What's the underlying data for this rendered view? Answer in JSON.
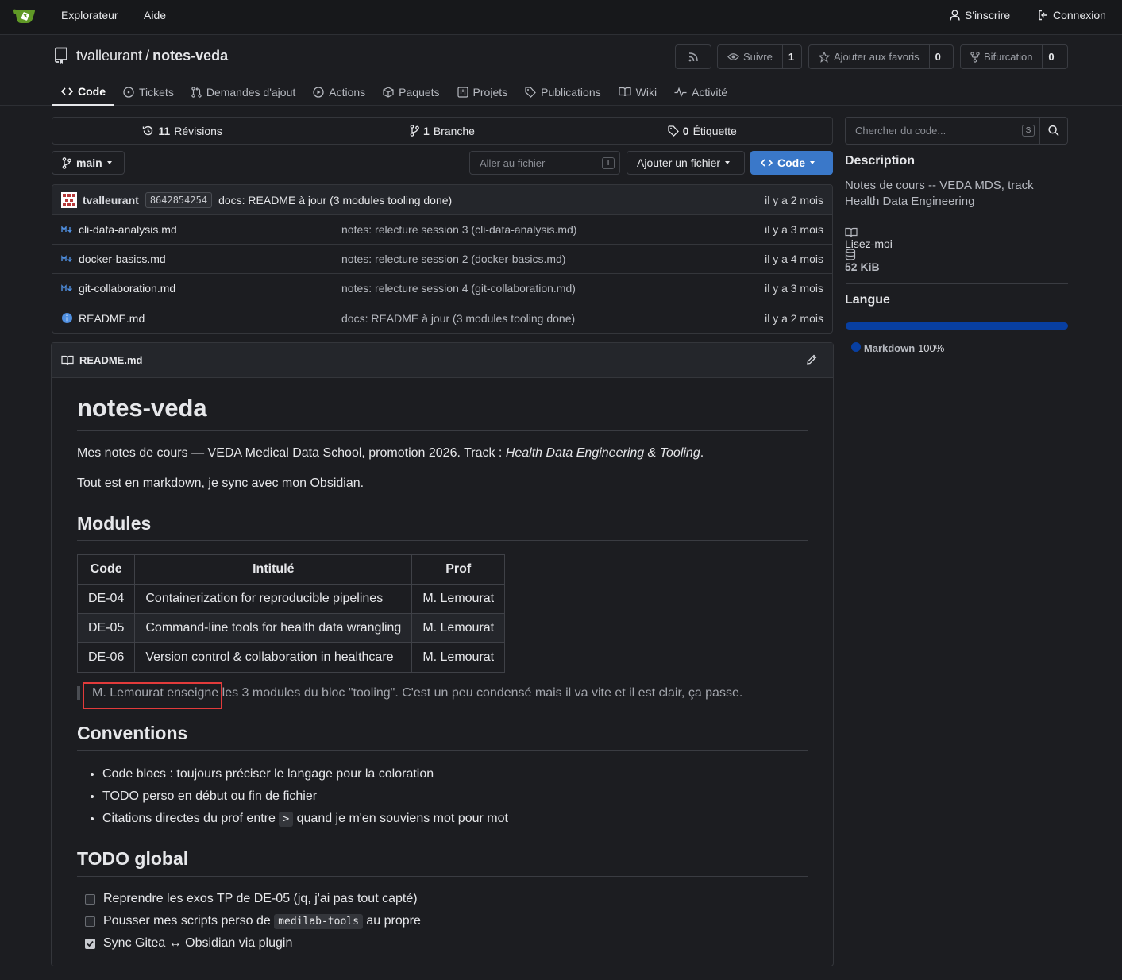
{
  "topnav": {
    "explorer": "Explorateur",
    "help": "Aide",
    "signup": "S'inscrire",
    "signin": "Connexion"
  },
  "repo": {
    "owner": "tvalleurant",
    "separator": "/",
    "name": "notes-veda",
    "watch_label": "Suivre",
    "watch_count": "1",
    "star_label": "Ajouter aux favoris",
    "star_count": "0",
    "fork_label": "Bifurcation",
    "fork_count": "0"
  },
  "tabs": [
    {
      "label": "Code"
    },
    {
      "label": "Tickets"
    },
    {
      "label": "Demandes d'ajout"
    },
    {
      "label": "Actions"
    },
    {
      "label": "Paquets"
    },
    {
      "label": "Projets"
    },
    {
      "label": "Publications"
    },
    {
      "label": "Wiki"
    },
    {
      "label": "Activité"
    }
  ],
  "stats": {
    "revisions_count": "11",
    "revisions_label": "Révisions",
    "branches_count": "1",
    "branches_label": "Branche",
    "tags_count": "0",
    "tags_label": "Étiquette"
  },
  "toolbar": {
    "branch": "main",
    "goto_file_placeholder": "Aller au fichier",
    "goto_file_shortcut": "T",
    "add_file": "Ajouter un fichier",
    "code_button": "Code"
  },
  "last_commit": {
    "author": "tvalleurant",
    "sha": "8642854254",
    "message": "docs: README à jour (3 modules tooling done)",
    "ago": "il y a 2 mois"
  },
  "files": [
    {
      "name": "cli-data-analysis.md",
      "message": "notes: relecture session 3 (cli-data-analysis.md)",
      "ago": "il y a 3 mois",
      "icon": "markdown-icon"
    },
    {
      "name": "docker-basics.md",
      "message": "notes: relecture session 2 (docker-basics.md)",
      "ago": "il y a 4 mois",
      "icon": "markdown-icon"
    },
    {
      "name": "git-collaboration.md",
      "message": "notes: relecture session 4 (git-collaboration.md)",
      "ago": "il y a 3 mois",
      "icon": "markdown-icon"
    },
    {
      "name": "README.md",
      "message": "docs: README à jour (3 modules tooling done)",
      "ago": "il y a 2 mois",
      "icon": "info-icon"
    }
  ],
  "readme": {
    "filename": "README.md",
    "title": "notes-veda",
    "intro_prefix": "Mes notes de cours — VEDA Medical Data School, promotion 2026. Track : ",
    "intro_em": "Health Data Engineering & Tooling",
    "intro_suffix": ".",
    "intro2": "Tout est en markdown, je sync avec mon Obsidian.",
    "modules_heading": "Modules",
    "table": {
      "headers": [
        "Code",
        "Intitulé",
        "Prof"
      ],
      "rows": [
        [
          "DE-04",
          "Containerization for reproducible pipelines",
          "M. Lemourat"
        ],
        [
          "DE-05",
          "Command-line tools for health data wrangling",
          "M. Lemourat"
        ],
        [
          "DE-06",
          "Version control & collaboration in healthcare",
          "M. Lemourat"
        ]
      ]
    },
    "quote": "M. Lemourat enseigne les 3 modules du bloc \"tooling\". C'est un peu condensé mais il va vite et il est clair, ça passe.",
    "conventions_heading": "Conventions",
    "conventions": [
      "Code blocs : toujours préciser le langage pour la coloration",
      "TODO perso en début ou fin de fichier"
    ],
    "convention3_prefix": "Citations directes du prof entre ",
    "convention3_code": ">",
    "convention3_suffix": " quand je m'en souviens mot pour mot",
    "todo_heading": "TODO global",
    "todo1": "Reprendre les exos TP de DE-05 (jq, j'ai pas tout capté)",
    "todo2_prefix": "Pousser mes scripts perso de ",
    "todo2_code": "medilab-tools",
    "todo2_suffix": " au propre",
    "todo3": "Sync Gitea ↔ Obsidian via plugin",
    "todo_checked": [
      false,
      false,
      true
    ]
  },
  "sidebar": {
    "search_placeholder": "Chercher du code...",
    "search_shortcut": "S",
    "description_heading": "Description",
    "description": "Notes de cours -- VEDA MDS, track Health Data Engineering",
    "readme_link": "Lisez-moi",
    "size": "52 KiB",
    "language_heading": "Langue",
    "language": "Markdown",
    "language_percent": "100%",
    "language_color": "#083fa1"
  },
  "colors": {
    "accent": "#3a78c9",
    "highlight_box": "#e23b3b",
    "logo_green": "#609926"
  }
}
